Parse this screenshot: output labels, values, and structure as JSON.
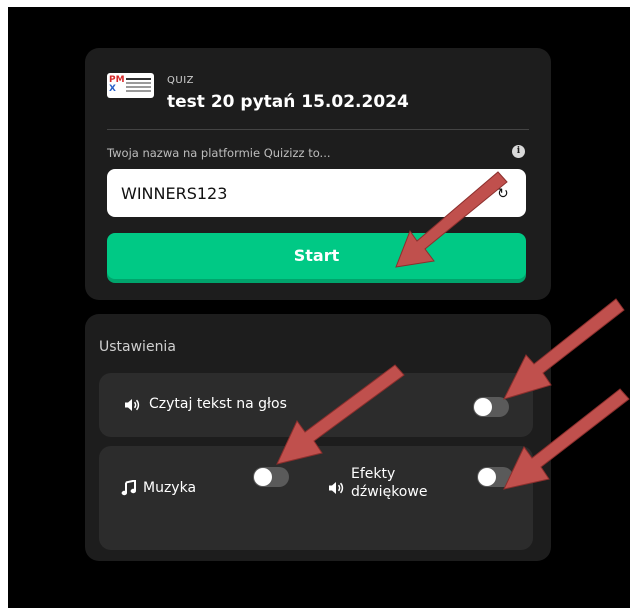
{
  "quiz": {
    "type_label": "QUIZ",
    "title": "test 20 pytań 15.02.2024",
    "name_label": "Twoja nazwa na platformie Quizizz to...",
    "name_value": "WINNERS123",
    "start_label": "Start"
  },
  "settings": {
    "title": "Ustawienia",
    "read_aloud_label": "Czytaj tekst na głos",
    "read_aloud_on": false,
    "music_label": "Muzyka",
    "music_on": false,
    "sound_effects_label_line1": "Efekty",
    "sound_effects_label_line2": "dźwiękowe",
    "sound_effects_on": false
  },
  "colors": {
    "background": "#000000",
    "card": "#1d1d1d",
    "row": "#2c2c2c",
    "accent": "#00c985",
    "annotation_arrow": "#c0504d"
  },
  "icons": [
    "info-icon",
    "speaker-icon",
    "music-note-icon",
    "logo"
  ]
}
